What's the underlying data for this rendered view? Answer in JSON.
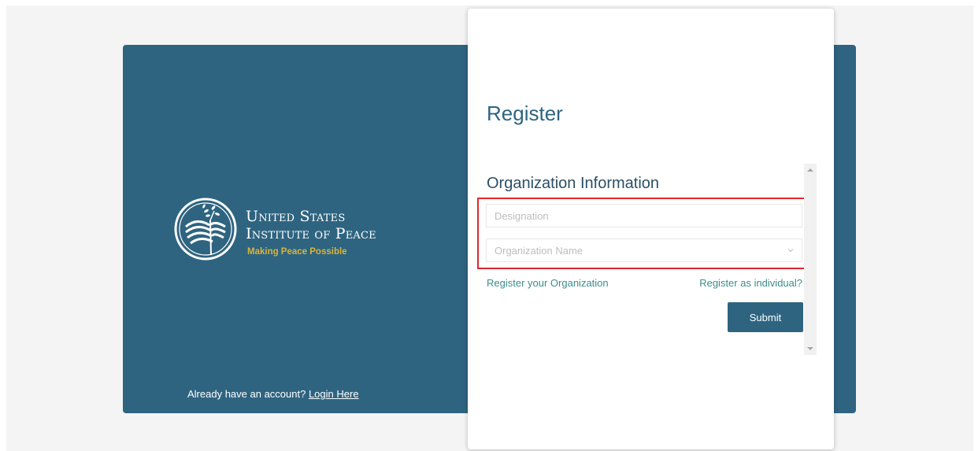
{
  "colors": {
    "brand_panel": "#2e6480",
    "tagline": "#d9b43c",
    "link": "#3d8c8c",
    "highlight": "#e1262c",
    "button": "#2e6480"
  },
  "brand": {
    "logo_icon": "dove-olive-branch-emblem-icon",
    "name_line1": "United States",
    "name_line2": "Institute of Peace",
    "tagline": "Making Peace Possible"
  },
  "login": {
    "prompt": "Already have an account?",
    "link_label": "Login Here"
  },
  "register": {
    "title": "Register",
    "section_heading": "Organization Information",
    "designation_placeholder": "Designation",
    "organization_placeholder": "Organization Name",
    "organization_icon": "chevron-down-icon",
    "register_org_link": "Register your Organization",
    "register_individual_link": "Register as individual?",
    "submit_label": "Submit"
  }
}
